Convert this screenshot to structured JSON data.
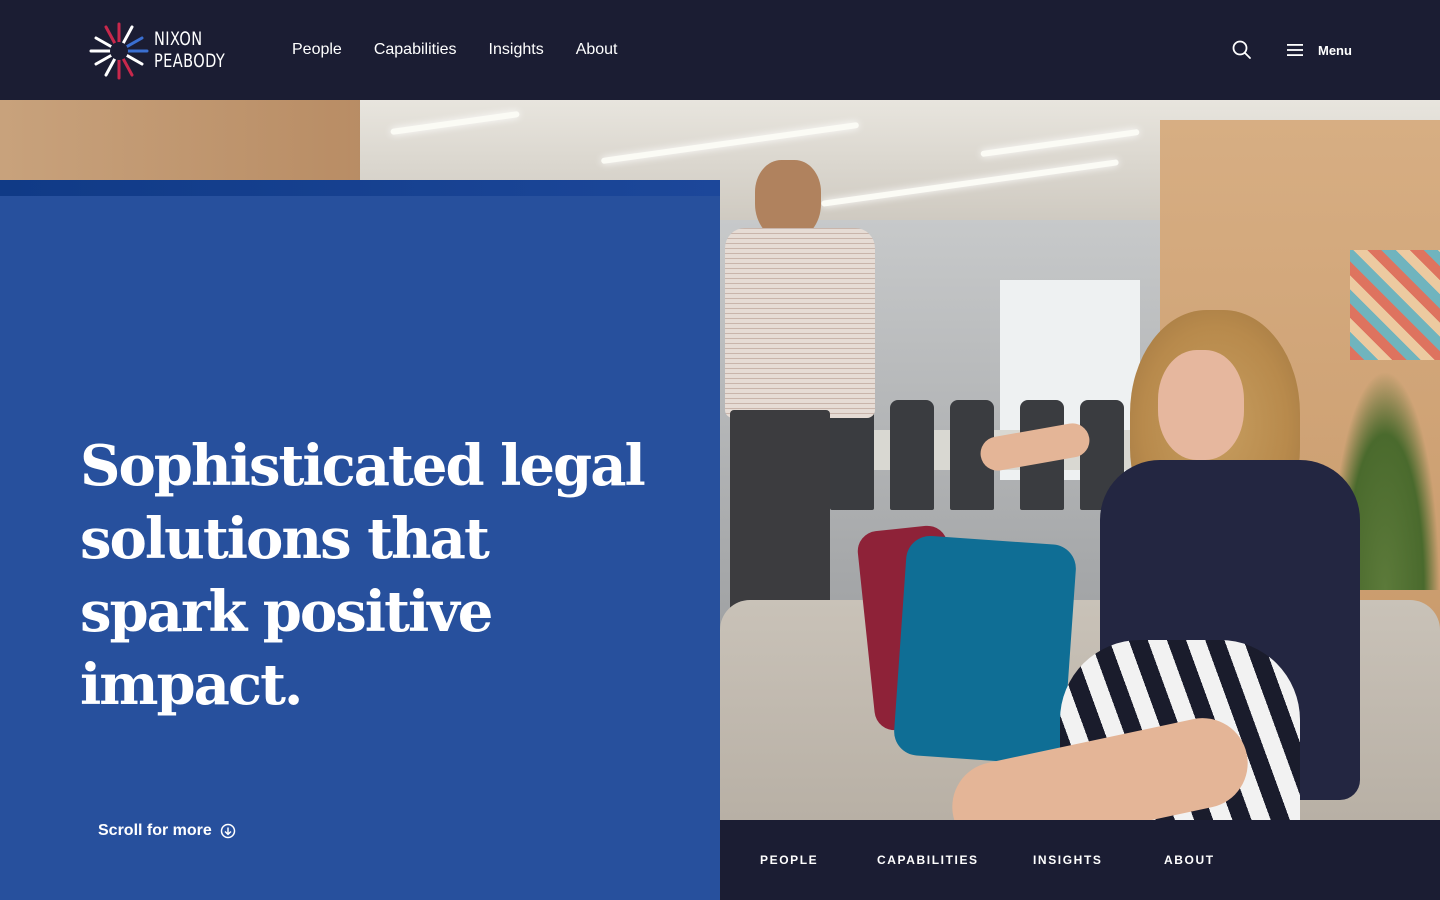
{
  "brand": {
    "name_line1": "NIXON",
    "name_line2": "PEABODY",
    "logo_icon": "starburst-icon",
    "colors": {
      "navy": "#1b1d33",
      "blue": "#27509d",
      "red": "#c8284c"
    }
  },
  "header": {
    "nav": [
      {
        "label": "People"
      },
      {
        "label": "Capabilities"
      },
      {
        "label": "Insights"
      },
      {
        "label": "About"
      }
    ],
    "search_icon": "search-icon",
    "menu_icon": "hamburger-icon",
    "menu_label": "Menu"
  },
  "hero": {
    "headline": "Sophisticated legal solutions that spark positive impact.",
    "scroll_label": "Scroll for more",
    "scroll_icon": "arrow-down-circle-icon"
  },
  "section_nav": {
    "items": [
      {
        "label": "PEOPLE"
      },
      {
        "label": "CAPABILITIES"
      },
      {
        "label": "INSIGHTS"
      },
      {
        "label": "ABOUT"
      }
    ]
  }
}
